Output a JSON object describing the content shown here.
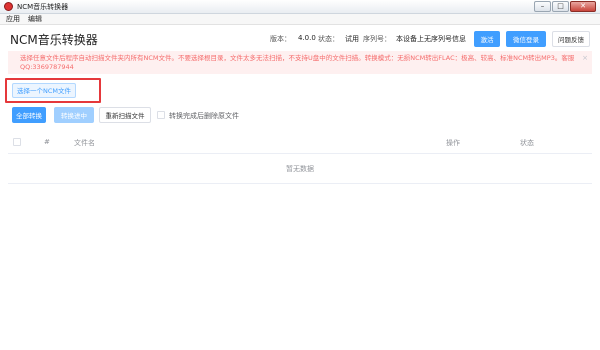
{
  "window": {
    "title": "NCM音乐转换器",
    "min_glyph": "–",
    "max_glyph": "□",
    "close_glyph": "✕"
  },
  "menu": {
    "items": [
      "应用",
      "编辑"
    ]
  },
  "header": {
    "title": "NCM音乐转换器",
    "version_label": "版本：",
    "version_value": "4.0.0",
    "status_label": "状态：",
    "status_value": "试用",
    "serial_label": "序列号：",
    "serial_value": "本设备上无序列号信息",
    "activate_button": "激活",
    "wechat_login_button": "微信登录",
    "feedback_button": "问题反馈"
  },
  "warning": {
    "text": "选择任意文件后程序自动扫描文件夹内所有NCM文件。不要选择根目录，文件太多无法扫描，不支持U盘中的文件扫描。转换模式：无损NCM转出FLAC：极高、较高、标准NCM转出MP3。客服QQ:3369787944",
    "close_glyph": "×"
  },
  "toolbar": {
    "select_file_button": "选择一个NCM文件",
    "convert_all_button": "全部转换",
    "converting_button": "转换进中",
    "rescan_button": "重新扫描文件",
    "delete_after_label": "转换完成后删除原文件"
  },
  "table": {
    "columns": {
      "index": "#",
      "filename": "文件名",
      "action": "操作",
      "status": "状态"
    },
    "empty_text": "暂无数据"
  },
  "colors": {
    "primary": "#409eff",
    "warning_bg": "#fef0f0",
    "warning_text": "#f56c6c",
    "highlight": "#e5383b"
  }
}
